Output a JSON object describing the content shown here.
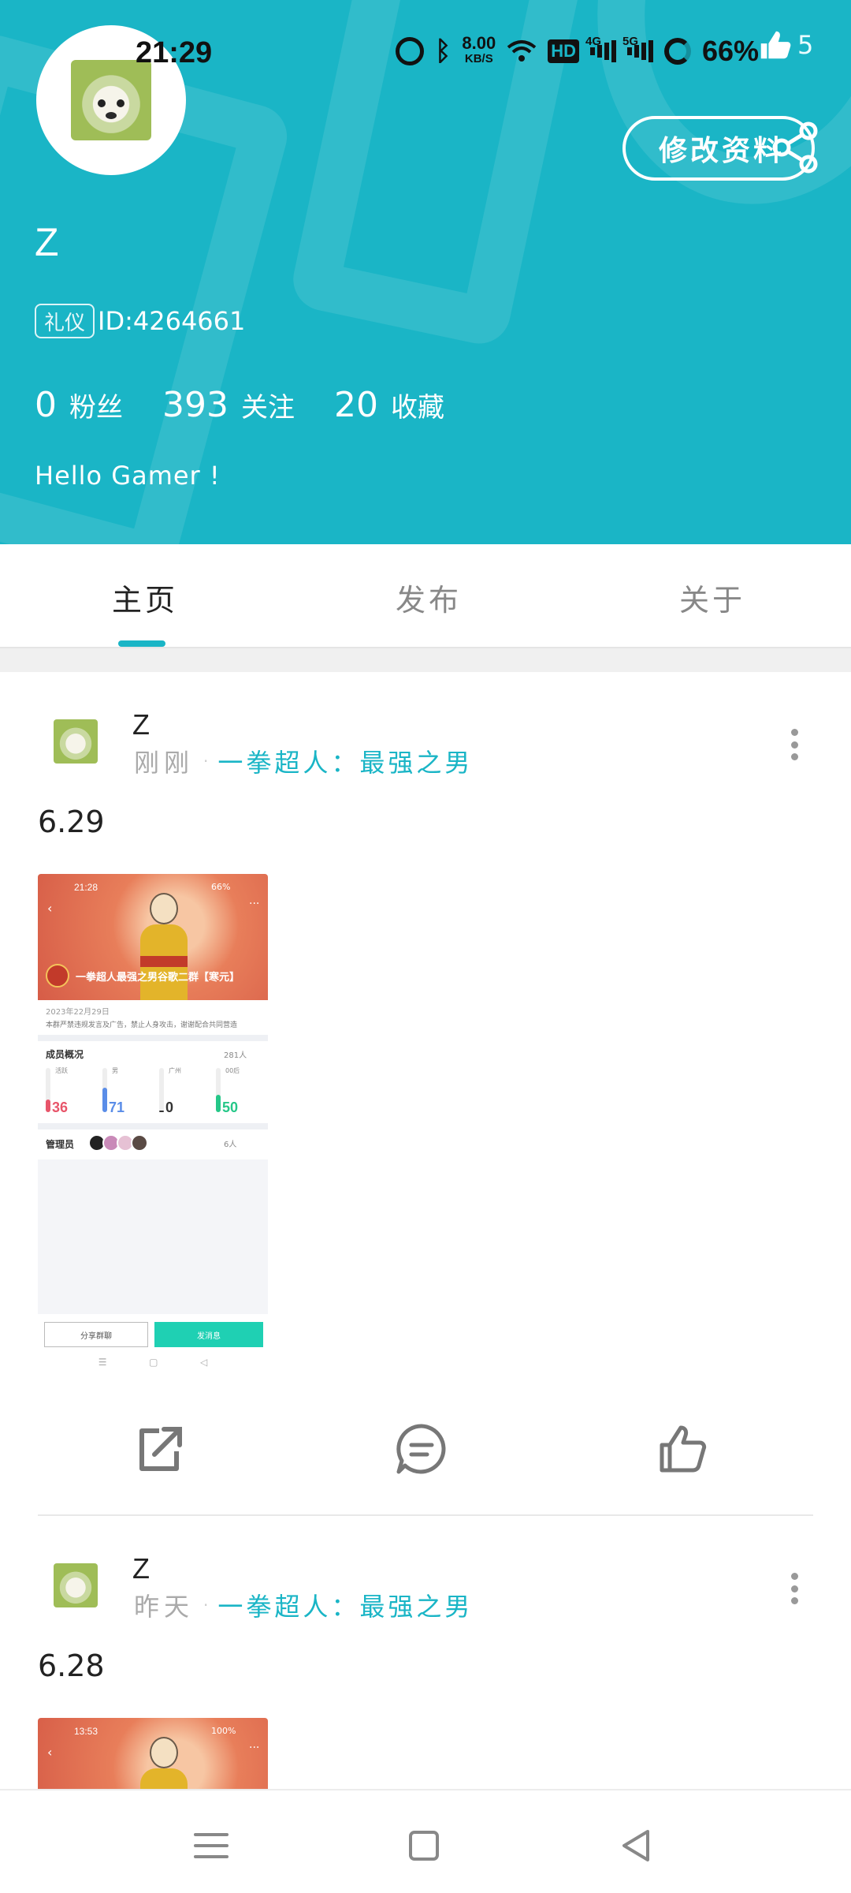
{
  "status_bar": {
    "time": "21:29",
    "speed_value": "8.00",
    "speed_unit": "KB/S",
    "hd_label": "HD",
    "net1": "4G",
    "net2": "5G",
    "battery_pct": "66%",
    "icons": [
      "alarm-icon",
      "bluetooth-icon",
      "wifi-icon",
      "battery-icon"
    ]
  },
  "header": {
    "like_count": "5",
    "edit_button": "修改资料",
    "username": "Z",
    "role_badge": "礼仪",
    "user_id": "ID:4264661",
    "stats": [
      {
        "value": "0",
        "label": "粉丝"
      },
      {
        "value": "393",
        "label": "关注"
      },
      {
        "value": "20",
        "label": "收藏"
      }
    ],
    "bio": "Hello Gamer !",
    "accent_color": "#1ab5c6"
  },
  "tabs": [
    {
      "label": "主页",
      "active": true
    },
    {
      "label": "发布",
      "active": false
    },
    {
      "label": "关于",
      "active": false
    }
  ],
  "posts": [
    {
      "author": "Z",
      "time": "刚刚",
      "topic": "一拳超人：最强之男",
      "text": "6.29",
      "image": {
        "time": "21:28",
        "status": "66%",
        "title": "一拳超人最强之男谷歌二群【寒元】",
        "sub": "2023年22月29日",
        "desc": "本群严禁违规发言及广告，禁止人身攻击，谢谢配合共同营造",
        "section1": "成员概况",
        "section1_count": "281人",
        "bars": [
          {
            "label": "活跃",
            "pct": "36",
            "color": "#e8556a",
            "level": 0.36
          },
          {
            "label": "男",
            "pct": "71",
            "color": "#5a8de8",
            "level": 0.71
          },
          {
            "label": "广州",
            "pct": "0",
            "color": "#333333",
            "level": 0.0
          },
          {
            "label": "00后",
            "pct": "50",
            "color": "#25c788",
            "level": 0.5
          }
        ],
        "section2": "管理员",
        "section2_count": "6人",
        "button_left": "分享群聊",
        "button_right": "发消息"
      }
    },
    {
      "author": "Z",
      "time": "昨天",
      "topic": "一拳超人：最强之男",
      "text": "6.28",
      "image": {
        "time": "13:53",
        "status": "100%"
      }
    }
  ],
  "action_icons": [
    "share-icon",
    "comment-icon",
    "like-icon"
  ],
  "nav_icons": [
    "menu-icon",
    "home-icon",
    "back-icon"
  ]
}
